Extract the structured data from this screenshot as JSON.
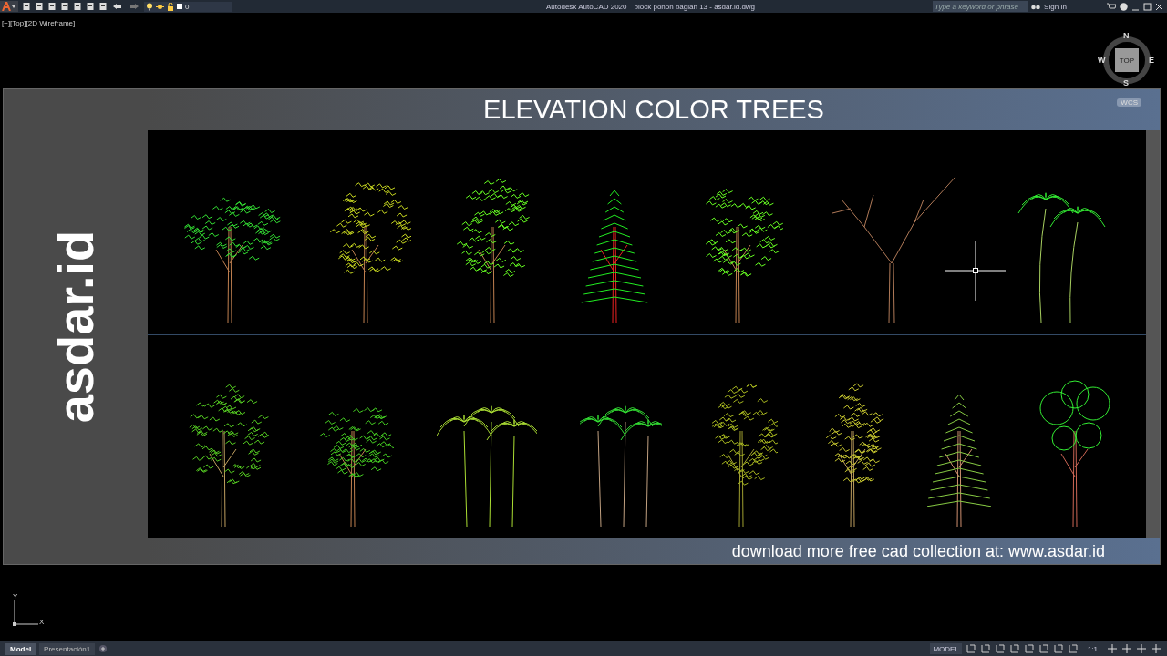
{
  "title_bar": {
    "layer": "0",
    "app_name": "Autodesk AutoCAD 2020",
    "file_name": "block pohon bagian 13 - asdar.id.dwg",
    "search": {
      "placeholder": "Type a keyword or phrase"
    },
    "sign_in": "Sign In"
  },
  "viewport": {
    "label": "[−][Top][2D Wireframe]"
  },
  "viewcube": {
    "north": "N",
    "west": "W",
    "east": "E",
    "south": "S",
    "face": "TOP",
    "ucs": "WCS"
  },
  "drawing": {
    "logo": "asdar.id",
    "title": "ELEVATION COLOR TREES",
    "footer": "download more free cad collection at: www.asdar.id"
  },
  "ucs_icon": {
    "y": "Y",
    "x": "X"
  },
  "layout_tabs": [
    {
      "label": "Model",
      "selected": true
    },
    {
      "label": "Presentación1",
      "selected": false
    }
  ],
  "status_bar": {
    "space": "MODEL",
    "scale": "1:1"
  }
}
